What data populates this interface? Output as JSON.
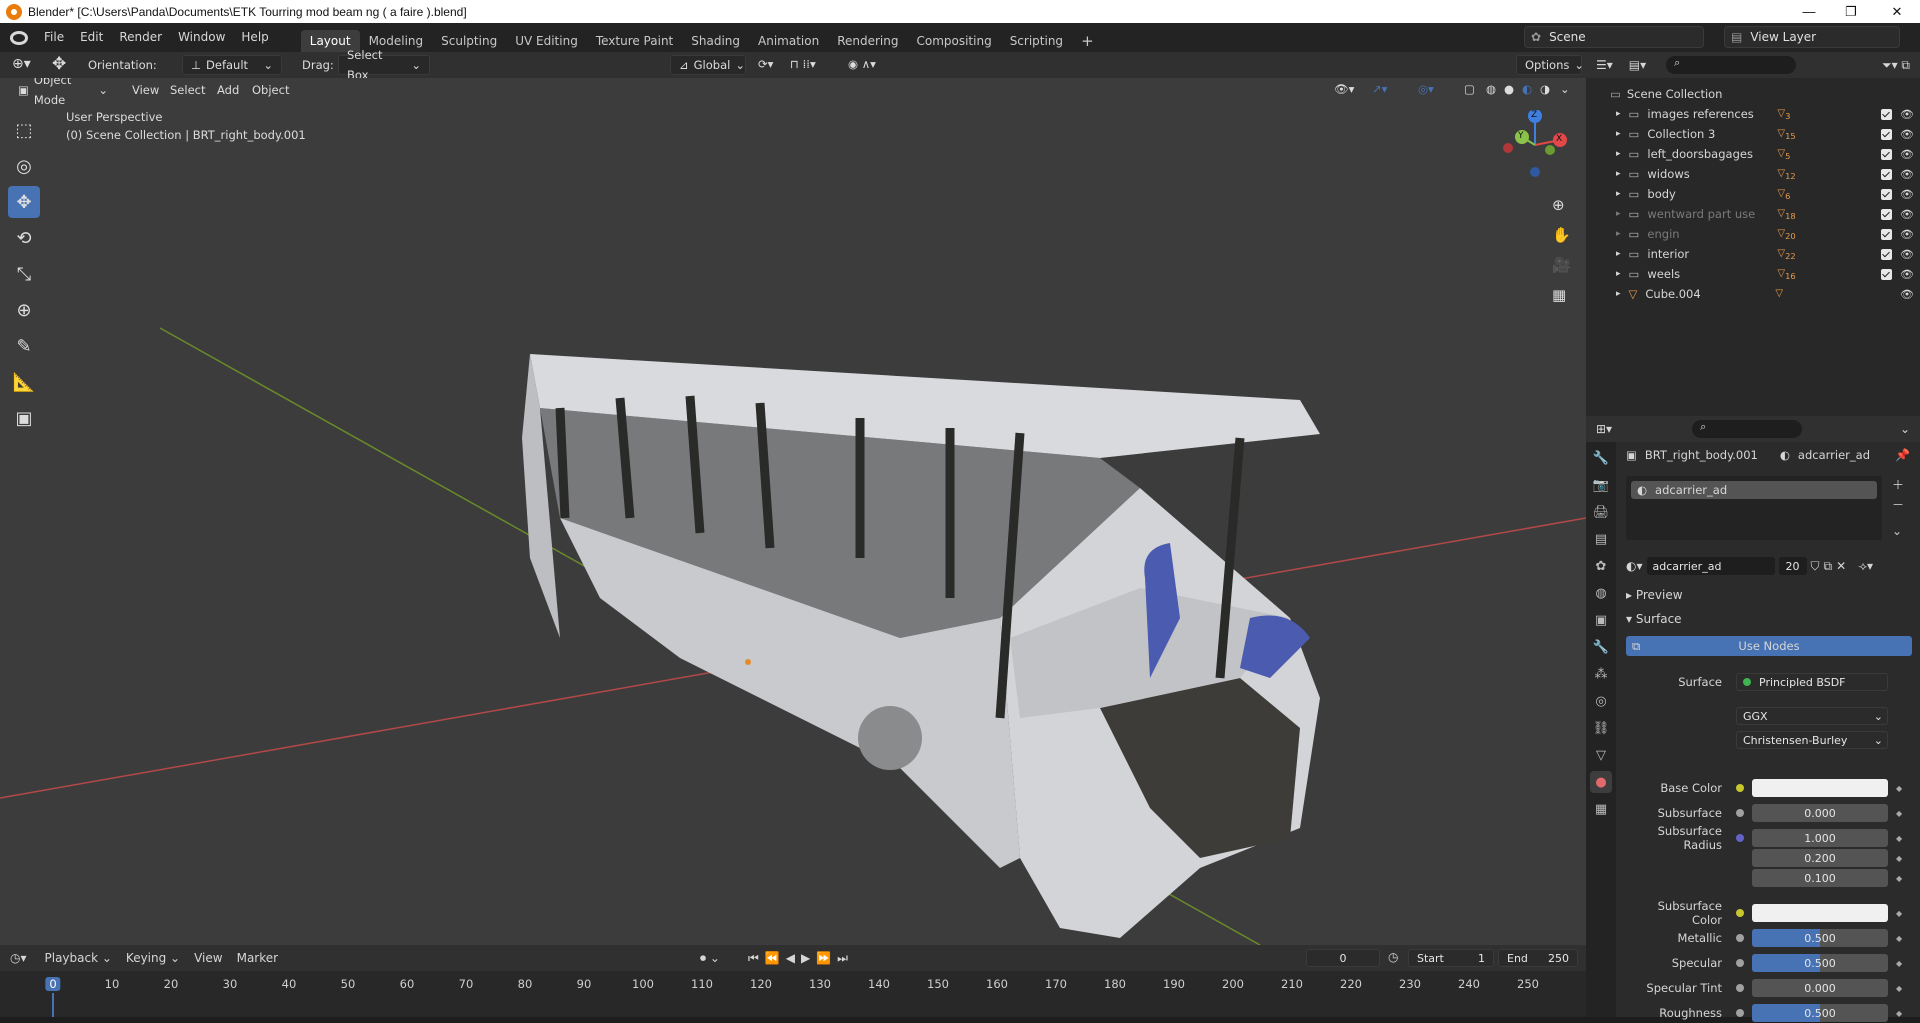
{
  "window": {
    "title": "Blender* [C:\\Users\\Panda\\Documents\\ETK Tourring mod beam ng ( a faire ).blend]",
    "minimize": "—",
    "maximize": "❐",
    "close": "✕"
  },
  "menu": [
    "File",
    "Edit",
    "Render",
    "Window",
    "Help"
  ],
  "workspaces": [
    "Layout",
    "Modeling",
    "Sculpting",
    "UV Editing",
    "Texture Paint",
    "Shading",
    "Animation",
    "Rendering",
    "Compositing",
    "Scripting"
  ],
  "active_workspace": "Layout",
  "add_workspace": "+",
  "scene": {
    "name": "Scene",
    "view_layer": "View Layer"
  },
  "viewport_header": {
    "orientation_label": "Orientation:",
    "orientation_value": "Default",
    "drag_label": "Drag:",
    "drag_value": "Select Box",
    "transform_orientation": "Global",
    "options": "Options"
  },
  "viewport_header2": {
    "mode": "Object Mode",
    "menus": [
      "View",
      "Select",
      "Add",
      "Object"
    ]
  },
  "viewport_info": {
    "line1": "User Perspective",
    "line2": "(0) Scene Collection | BRT_right_body.001"
  },
  "gizmo": {
    "z": "Z",
    "y": "Y",
    "x": "X"
  },
  "outliner": {
    "root": "Scene Collection",
    "items": [
      {
        "name": "images references",
        "badge": "3",
        "dim": false,
        "checked": true
      },
      {
        "name": "Collection 3",
        "badge": "15",
        "dim": false,
        "checked": true
      },
      {
        "name": "left_doorsbagages",
        "badge": "5",
        "dim": false,
        "checked": true
      },
      {
        "name": "widows",
        "badge": "12",
        "dim": false,
        "checked": true
      },
      {
        "name": "body",
        "badge": "6",
        "dim": false,
        "checked": true
      },
      {
        "name": "wentward part use",
        "badge": "18",
        "dim": true,
        "checked": true
      },
      {
        "name": "engin",
        "badge": "20",
        "dim": true,
        "checked": true
      },
      {
        "name": "interior",
        "badge": "22",
        "dim": false,
        "checked": true
      },
      {
        "name": "weels",
        "badge": "16",
        "dim": false,
        "checked": true
      },
      {
        "name": "Cube.004",
        "badge": "",
        "dim": false,
        "checked": false
      }
    ]
  },
  "properties": {
    "object_name": "BRT_right_body.001",
    "material_name": "adcarrier_ad",
    "slot_name": "adcarrier_ad",
    "material_field": "adcarrier_ad",
    "users": "20",
    "sections": {
      "preview": "Preview",
      "surface": "Surface"
    },
    "use_nodes": "Use Nodes",
    "surface_label": "Surface",
    "surface_value": "Principled BSDF",
    "distribution": "GGX",
    "subsurface_method": "Christensen-Burley",
    "params": [
      {
        "label": "Base Color",
        "type": "color",
        "value": ""
      },
      {
        "label": "Subsurface",
        "type": "num",
        "value": "0.000"
      },
      {
        "label": "Subsurface Radius",
        "type": "vec",
        "value": "1.000"
      },
      {
        "label": "",
        "type": "vec",
        "value": "0.200"
      },
      {
        "label": "",
        "type": "vec",
        "value": "0.100"
      },
      {
        "label": "Subsurface Color",
        "type": "color",
        "value": ""
      },
      {
        "label": "Metallic",
        "type": "slider",
        "value": "0.500"
      },
      {
        "label": "Specular",
        "type": "slider",
        "value": "0.500"
      },
      {
        "label": "Specular Tint",
        "type": "num",
        "value": "0.000"
      },
      {
        "label": "Roughness",
        "type": "slider",
        "value": "0.500"
      }
    ]
  },
  "timeline": {
    "menus": [
      "Playback",
      "Keying",
      "View",
      "Marker"
    ],
    "current_frame": "0",
    "start_label": "Start",
    "start": "1",
    "end_label": "End",
    "end": "250",
    "ticks": [
      "0",
      "10",
      "20",
      "30",
      "40",
      "50",
      "60",
      "70",
      "80",
      "90",
      "100",
      "110",
      "120",
      "130",
      "140",
      "150",
      "160",
      "170",
      "180",
      "190",
      "200",
      "210",
      "220",
      "230",
      "240",
      "250"
    ]
  },
  "colors": {
    "accent": "#4772b3",
    "active_frame": "#4772b3",
    "x_axis": "#e24848",
    "y_axis": "#8bc34a",
    "z_axis": "#3f7fe0"
  }
}
